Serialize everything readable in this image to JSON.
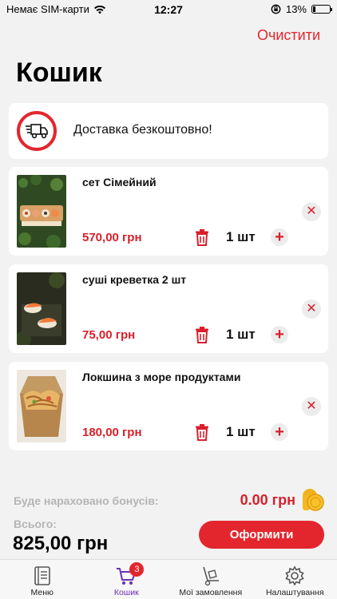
{
  "status_bar": {
    "carrier": "Немає SIM-карти",
    "time": "12:27",
    "battery": "13%"
  },
  "header": {
    "clear_label": "Очистити",
    "title": "Кошик"
  },
  "delivery": {
    "text": "Доставка безкоштовно!",
    "icon": "delivery-truck-icon"
  },
  "cart": {
    "items": [
      {
        "name": "сет Сімейний",
        "price": "570,00 грн",
        "qty": "1 шт"
      },
      {
        "name": "суші креветка  2 шт",
        "price": "75,00 грн",
        "qty": "1 шт"
      },
      {
        "name": "Локшина з море продуктами",
        "price": "180,00 грн",
        "qty": "1 шт"
      }
    ]
  },
  "summary": {
    "bonus_label": "Буде нараховано бонусів:",
    "bonus_value": "0.00 грн",
    "total_label": "Всього:",
    "total_value": "825,00 грн",
    "checkout_label": "Оформити"
  },
  "tabs": [
    {
      "label": "Меню",
      "icon": "menu-book-icon",
      "active": false
    },
    {
      "label": "Кошик",
      "icon": "cart-icon",
      "active": true,
      "badge": "3"
    },
    {
      "label": "Мої замовлення",
      "icon": "hand-truck-icon",
      "active": false
    },
    {
      "label": "Налаштування",
      "icon": "gear-icon",
      "active": false
    }
  ],
  "colors": {
    "accent": "#e3262d",
    "price": "#d8202b",
    "active_tab": "#6b2fb3",
    "background": "#f2f2f2"
  }
}
